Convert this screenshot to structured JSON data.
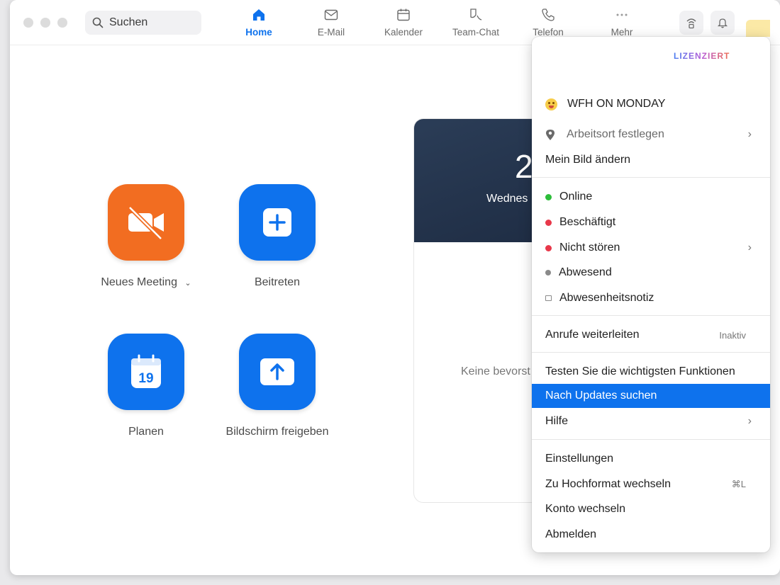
{
  "search": {
    "label": "Suchen"
  },
  "nav": [
    {
      "label": "Home",
      "icon": "home-icon"
    },
    {
      "label": "E-Mail",
      "icon": "mail-icon"
    },
    {
      "label": "Kalender",
      "icon": "calendar-icon"
    },
    {
      "label": "Team-Chat",
      "icon": "chat-icon"
    },
    {
      "label": "Telefon",
      "icon": "phone-icon"
    },
    {
      "label": "Mehr",
      "icon": "more-icon"
    }
  ],
  "home": {
    "tiles": [
      {
        "label": "Neues Meeting",
        "icon": "video-off-icon",
        "color": "#f26d21"
      },
      {
        "label": "Beitreten",
        "icon": "plus-icon",
        "color": "#0e72ed"
      },
      {
        "label": "Planen",
        "icon": "calendar-19-icon",
        "color": "#0e72ed",
        "calendar_day": "19"
      },
      {
        "label": "Bildschirm freigeben",
        "icon": "share-screen-icon",
        "color": "#0e72ed"
      }
    ],
    "card": {
      "big_number": "2",
      "day_partial": "Wednes",
      "empty_partial": "Keine bevorst"
    }
  },
  "menu": {
    "badge": "LIZENZIERT",
    "status_message": "WFH ON MONDAY",
    "set_location": "Arbeitsort festlegen",
    "change_picture": "Mein Bild ändern",
    "presence": [
      {
        "label": "Online",
        "color": "#2dbd3a"
      },
      {
        "label": "Beschäftigt",
        "color": "#e8384a"
      },
      {
        "label": "Nicht stören",
        "color": "#e8384a"
      },
      {
        "label": "Abwesend",
        "color": "#8a8a8a"
      },
      {
        "label": "Abwesenheitsnotiz",
        "color": "#8a8a8a"
      }
    ],
    "forward_calls": {
      "label": "Anrufe weiterleiten",
      "state": "Inaktiv"
    },
    "test_features": "Testen Sie die wichtigsten Funktionen",
    "check_updates": "Nach Updates suchen",
    "help": "Hilfe",
    "settings": "Einstellungen",
    "portrait": {
      "label": "Zu Hochformat wechseln",
      "shortcut": "⌘L"
    },
    "switch_account": "Konto wechseln",
    "sign_out": "Abmelden"
  },
  "colors": {
    "accent": "#0e72ed",
    "orange": "#f26d21"
  }
}
